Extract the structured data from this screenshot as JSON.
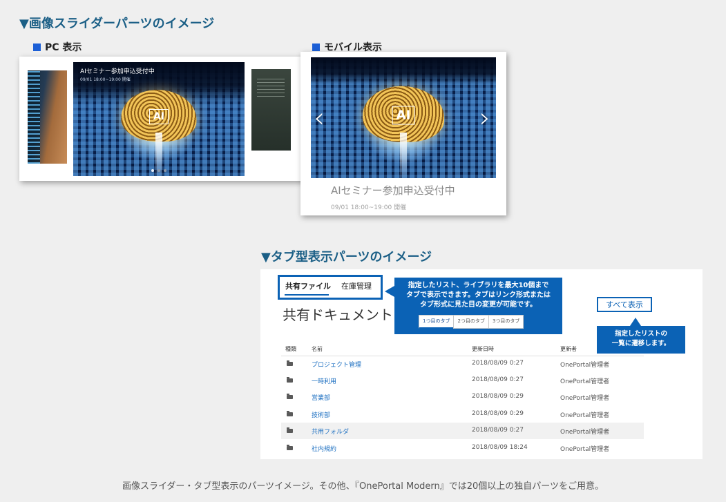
{
  "slider_section": {
    "heading": "▼画像スライダーパーツのイメージ",
    "pc_label": "PC 表示",
    "mobile_label": "モバイル表示",
    "pc_slide": {
      "caption": "AIセミナー参加申込受付中",
      "caption_sub": "09/01 18:00~19:00 開催",
      "image_text": "AI",
      "dots": 3,
      "active_dot": 1
    },
    "mobile_slide": {
      "image_text": "AI",
      "title": "AIセミナー参加申込受付中",
      "date": "09/01 18:00~19:00 開催",
      "prev_icon": "‹",
      "next_icon": "›"
    }
  },
  "tab_section": {
    "heading": "▼タブ型表示パーツのイメージ",
    "tabs": [
      {
        "label": "共有ファイル",
        "active": true
      },
      {
        "label": "在庫管理",
        "active": false
      }
    ],
    "callout_lines": [
      "指定したリスト、ライブラリを最大10個まで",
      "タブで表示できます。タブはリンク形式または",
      "タブ形式に見た目の変更が可能です。"
    ],
    "mini_tabs": [
      "1つ目のタブ",
      "2つ目のタブ",
      "3つ目のタブ"
    ],
    "doc_title": "共有ドキュメント",
    "show_all_label": "すべて表示",
    "list_callout_lines": [
      "指定したリストの",
      "一覧に遷移します。"
    ],
    "columns": {
      "kind": "種類",
      "name": "名前",
      "date": "更新日時",
      "user": "更新者"
    },
    "rows": [
      {
        "name": "プロジェクト管理",
        "date": "2018/08/09 0:27",
        "user": "OnePortal管理者"
      },
      {
        "name": "一時利用",
        "date": "2018/08/09 0:27",
        "user": "OnePortal管理者"
      },
      {
        "name": "営業部",
        "date": "2018/08/09 0:29",
        "user": "OnePortal管理者"
      },
      {
        "name": "技術部",
        "date": "2018/08/09 0:29",
        "user": "OnePortal管理者"
      },
      {
        "name": "共用フォルダ",
        "date": "2018/08/09 0:27",
        "user": "OnePortal管理者"
      },
      {
        "name": "社内規約",
        "date": "2018/08/09 18:24",
        "user": "OnePortal管理者"
      }
    ]
  },
  "footer": "画像スライダー・タブ型表示のパーツイメージ。その他、『OnePortal Modern』では20個以上の独自パーツをご用意。",
  "colors": {
    "heading": "#1b5f86",
    "accent": "#0b62b5",
    "link": "#1c6fc1"
  }
}
